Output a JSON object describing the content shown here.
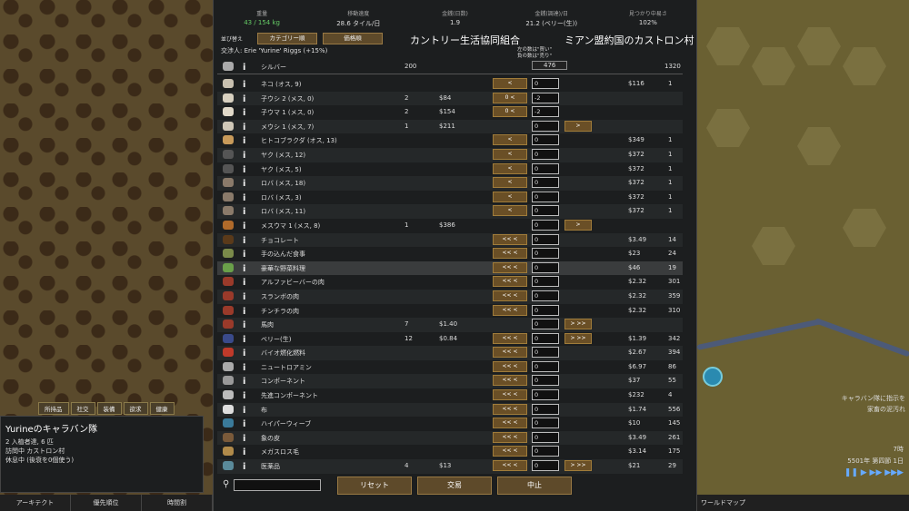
{
  "stats": [
    {
      "label": "重量",
      "value": "43 / 154 kg",
      "green": true
    },
    {
      "label": "移動速度",
      "value": "28.6 タイル/日"
    },
    {
      "label": "金銭(日数)",
      "value": "1.9"
    },
    {
      "label": "金銭(調達)/日",
      "value": "21.2 (ベリー(生))"
    },
    {
      "label": "見つかり中易さ",
      "value": "102%"
    }
  ],
  "header": {
    "sort_label": "並び替え",
    "sort1": "カテゴリー順",
    "sort2": "価格順",
    "trader_title": "カントリー生活協同組合",
    "colony_title": "ミアン盟約国のカストロン村",
    "negotiator": "交渉人: Erie 'Yurine' Riggs (+15%)",
    "hint1": "左の数は\"買い\"",
    "hint2": "負の数は\"売り\""
  },
  "silver": {
    "name": "シルバー",
    "ours": "200",
    "trade": "476",
    "theirs": "1320"
  },
  "rows": [
    {
      "name": "ネコ (オス, 9)",
      "ours": "",
      "price_sell": "",
      "qty": "0",
      "price_buy": "$116",
      "theirs": "1",
      "left": "<",
      "right": "",
      "icon": "#c8c0b0"
    },
    {
      "name": "子ウシ 2 (メス, 0)",
      "ours": "2",
      "price_sell": "$84",
      "qty": "-2",
      "price_buy": "",
      "theirs": "",
      "left": "0 <",
      "right": "",
      "icon": "#d8d0c0"
    },
    {
      "name": "子ウマ 1 (メス, 0)",
      "ours": "2",
      "price_sell": "$154",
      "qty": "-2",
      "price_buy": "",
      "theirs": "",
      "left": "0 <",
      "right": "",
      "icon": "#e0d8c8"
    },
    {
      "name": "メウシ 1 (メス, 7)",
      "ours": "1",
      "price_sell": "$211",
      "qty": "0",
      "price_buy": "",
      "theirs": "",
      "left": "",
      "right": ">",
      "icon": "#d0c8b8"
    },
    {
      "name": "ヒトコブラクダ (オス, 13)",
      "ours": "",
      "price_sell": "",
      "qty": "0",
      "price_buy": "$349",
      "theirs": "1",
      "left": "<",
      "right": "",
      "icon": "#c89a5a"
    },
    {
      "name": "ヤク (メス, 12)",
      "ours": "",
      "price_sell": "",
      "qty": "0",
      "price_buy": "$372",
      "theirs": "1",
      "left": "<",
      "right": "",
      "icon": "#555"
    },
    {
      "name": "ヤク (メス, 5)",
      "ours": "",
      "price_sell": "",
      "qty": "0",
      "price_buy": "$372",
      "theirs": "1",
      "left": "<",
      "right": "",
      "icon": "#555"
    },
    {
      "name": "ロバ (メス, 18)",
      "ours": "",
      "price_sell": "",
      "qty": "0",
      "price_buy": "$372",
      "theirs": "1",
      "left": "<",
      "right": "",
      "icon": "#8a7a6a"
    },
    {
      "name": "ロバ (メス, 3)",
      "ours": "",
      "price_sell": "",
      "qty": "0",
      "price_buy": "$372",
      "theirs": "1",
      "left": "<",
      "right": "",
      "icon": "#8a7a6a"
    },
    {
      "name": "ロバ (メス, 11)",
      "ours": "",
      "price_sell": "",
      "qty": "0",
      "price_buy": "$372",
      "theirs": "1",
      "left": "<",
      "right": "",
      "icon": "#8a7a6a"
    },
    {
      "name": "メスウマ 1 (メス, 8)",
      "ours": "1",
      "price_sell": "$386",
      "qty": "0",
      "price_buy": "",
      "theirs": "",
      "left": "",
      "right": ">",
      "icon": "#b06a2a"
    },
    {
      "name": "チョコレート",
      "ours": "",
      "price_sell": "",
      "qty": "0",
      "price_buy": "$3.49",
      "theirs": "14",
      "left": "<< <",
      "right": "",
      "icon": "#5a3a1a"
    },
    {
      "name": "手の込んだ食事",
      "ours": "",
      "price_sell": "",
      "qty": "0",
      "price_buy": "$23",
      "theirs": "24",
      "left": "<< <",
      "right": "",
      "icon": "#7a8a4a"
    },
    {
      "name": "豪華な野菜料理",
      "ours": "",
      "price_sell": "",
      "qty": "0",
      "price_buy": "$46",
      "theirs": "19",
      "left": "<< <",
      "right": "",
      "icon": "#6aa04a",
      "hl": true
    },
    {
      "name": "アルファビーバーの肉",
      "ours": "",
      "price_sell": "",
      "qty": "0",
      "price_buy": "$2.32",
      "theirs": "301",
      "left": "<< <",
      "right": "",
      "icon": "#9a3a2a"
    },
    {
      "name": "スランボの肉",
      "ours": "",
      "price_sell": "",
      "qty": "0",
      "price_buy": "$2.32",
      "theirs": "359",
      "left": "<< <",
      "right": "",
      "icon": "#9a3a2a"
    },
    {
      "name": "チンチラの肉",
      "ours": "",
      "price_sell": "",
      "qty": "0",
      "price_buy": "$2.32",
      "theirs": "310",
      "left": "<< <",
      "right": "",
      "icon": "#9a3a2a"
    },
    {
      "name": "馬肉",
      "ours": "7",
      "price_sell": "$1.40",
      "qty": "0",
      "price_buy": "",
      "theirs": "",
      "left": "",
      "right": "> >>",
      "icon": "#9a3a2a"
    },
    {
      "name": "ベリー(生)",
      "ours": "12",
      "price_sell": "$0.84",
      "qty": "0",
      "price_buy": "$1.39",
      "theirs": "342",
      "left": "<< <",
      "right": "> >>",
      "icon": "#3a4a8a"
    },
    {
      "name": "バイオ燃化燃料",
      "ours": "",
      "price_sell": "",
      "qty": "0",
      "price_buy": "$2.67",
      "theirs": "394",
      "left": "<< <",
      "right": "",
      "icon": "#c03a2a"
    },
    {
      "name": "ニュートロアミン",
      "ours": "",
      "price_sell": "",
      "qty": "0",
      "price_buy": "$6.97",
      "theirs": "86",
      "left": "<< <",
      "right": "",
      "icon": "#aaa"
    },
    {
      "name": "コンポーネント",
      "ours": "",
      "price_sell": "",
      "qty": "0",
      "price_buy": "$37",
      "theirs": "55",
      "left": "<< <",
      "right": "",
      "icon": "#999"
    },
    {
      "name": "先進コンポーネント",
      "ours": "",
      "price_sell": "",
      "qty": "0",
      "price_buy": "$232",
      "theirs": "4",
      "left": "<< <",
      "right": "",
      "icon": "#bbb"
    },
    {
      "name": "布",
      "ours": "",
      "price_sell": "",
      "qty": "0",
      "price_buy": "$1.74",
      "theirs": "556",
      "left": "<< <",
      "right": "",
      "icon": "#ddd"
    },
    {
      "name": "ハイパーウィーブ",
      "ours": "",
      "price_sell": "",
      "qty": "0",
      "price_buy": "$10",
      "theirs": "145",
      "left": "<< <",
      "right": "",
      "icon": "#3a7a9a"
    },
    {
      "name": "象の皮",
      "ours": "",
      "price_sell": "",
      "qty": "0",
      "price_buy": "$3.49",
      "theirs": "261",
      "left": "<< <",
      "right": "",
      "icon": "#7a5a3a"
    },
    {
      "name": "メガスロス毛",
      "ours": "",
      "price_sell": "",
      "qty": "0",
      "price_buy": "$3.14",
      "theirs": "175",
      "left": "<< <",
      "right": "",
      "icon": "#b08a4a"
    },
    {
      "name": "医薬品",
      "ours": "4",
      "price_sell": "$13",
      "qty": "0",
      "price_buy": "$21",
      "theirs": "29",
      "left": "<< <",
      "right": "> >>",
      "icon": "#5a8a9a"
    }
  ],
  "buttons": {
    "reset": "リセット",
    "accept": "交易",
    "cancel": "中止"
  },
  "caravan": {
    "title": "Yurineのキャラバン隊",
    "line1": "2 入植者達, 6 匹",
    "line2": "訪問中 カストロン村",
    "line3": "休息中 (後衰を0個使う)"
  },
  "caravan_tabs": [
    "所持品",
    "社交",
    "装備",
    "欲求",
    "健康"
  ],
  "bottom_left": [
    "アーキテクト",
    "優先順位",
    "時間割"
  ],
  "bottom_right": {
    "worldmap": "ワールドマップ"
  },
  "map_info": {
    "alert1": "キャラバン隊に指示を",
    "alert2": "家畜の泥汚れ",
    "date": "5501年 第四節 1日",
    "time": "7時"
  }
}
